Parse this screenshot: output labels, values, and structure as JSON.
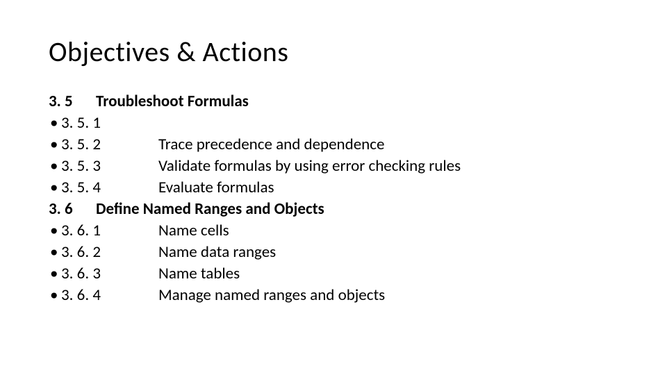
{
  "title": "Objectives & Actions",
  "sections": [
    {
      "number": "3. 5",
      "label": "Troubleshoot Formulas",
      "items": [
        {
          "number": "3. 5. 1",
          "label": ""
        },
        {
          "number": "3. 5. 2",
          "label": "Trace precedence and dependence"
        },
        {
          "number": "3. 5. 3",
          "label": "Validate formulas by using error checking rules"
        },
        {
          "number": "3. 5. 4",
          "label": "Evaluate formulas"
        }
      ]
    },
    {
      "number": "3. 6",
      "label": "Define Named Ranges and Objects",
      "items": [
        {
          "number": "3. 6. 1",
          "label": "Name cells"
        },
        {
          "number": "3. 6. 2",
          "label": "Name data ranges"
        },
        {
          "number": "3. 6. 3",
          "label": "Name tables"
        },
        {
          "number": "3. 6. 4",
          "label": "Manage named ranges and objects"
        }
      ]
    }
  ],
  "bullet": "•"
}
